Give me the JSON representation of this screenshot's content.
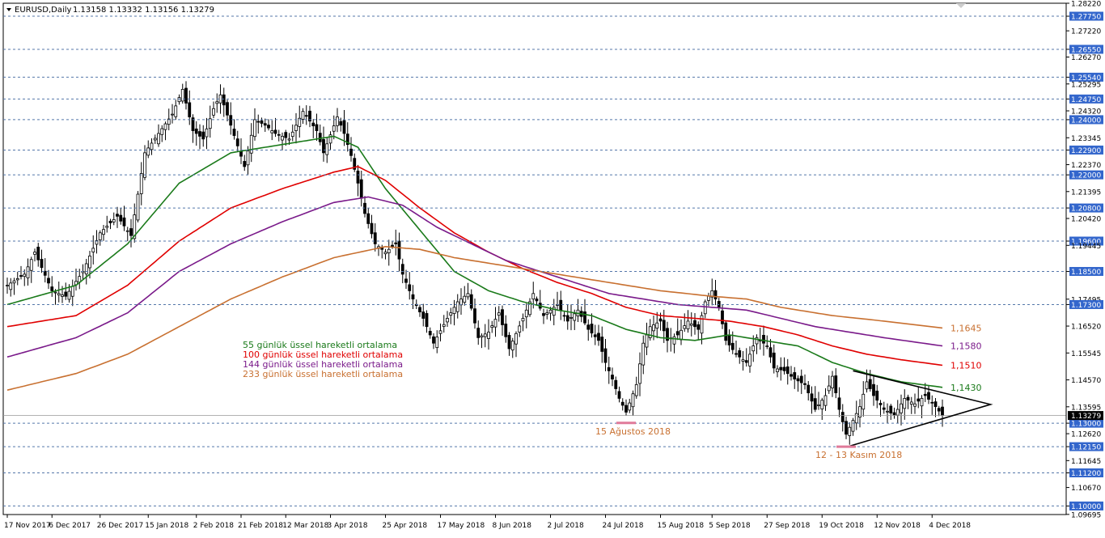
{
  "chart_data": {
    "type": "candlestick",
    "symbol_title": "EURUSD,Daily",
    "ohlc_readout": "1.13158 1.13332 1.13156 1.13279",
    "current_price": "1.13279",
    "ylim": [
      1.0969,
      1.2822
    ],
    "y_ticks": [
      "1.28220",
      "1.27750",
      "1.27220",
      "1.26550",
      "1.26270",
      "1.25540",
      "1.25295",
      "1.24750",
      "1.24320",
      "1.24000",
      "1.23345",
      "1.22900",
      "1.22370",
      "1.22000",
      "1.21395",
      "1.20800",
      "1.20420",
      "1.19600",
      "1.19445",
      "1.18500",
      "1.17495",
      "1.17300",
      "1.16520",
      "1.15545",
      "1.14570",
      "1.13595",
      "1.13000",
      "1.12620",
      "1.12150",
      "1.11645",
      "1.11200",
      "1.10670",
      "1.10000",
      "1.09695"
    ],
    "highlighted_levels": [
      "1.27750",
      "1.26550",
      "1.25540",
      "1.24750",
      "1.24000",
      "1.22900",
      "1.22000",
      "1.20800",
      "1.19600",
      "1.18500",
      "1.17300",
      "1.13000",
      "1.12150",
      "1.11200",
      "1.10000"
    ],
    "x_labels": [
      {
        "label": "17 Nov 2017",
        "i": 0
      },
      {
        "label": "6 Dec 2017",
        "i": 13
      },
      {
        "label": "26 Dec 2017",
        "i": 27
      },
      {
        "label": "15 Jan 2018",
        "i": 41
      },
      {
        "label": "2 Feb 2018",
        "i": 55
      },
      {
        "label": "21 Feb 2018",
        "i": 68
      },
      {
        "label": "12 Mar 2018",
        "i": 81
      },
      {
        "label": "3 Apr 2018",
        "i": 94
      },
      {
        "label": "25 Apr 2018",
        "i": 110
      },
      {
        "label": "17 May 2018",
        "i": 126
      },
      {
        "label": "8 Jun 2018",
        "i": 142
      },
      {
        "label": "2 Jul 2018",
        "i": 158
      },
      {
        "label": "24 Jul 2018",
        "i": 174
      },
      {
        "label": "15 Aug 2018",
        "i": 190
      },
      {
        "label": "5 Sep 2018",
        "i": 205
      },
      {
        "label": "27 Sep 2018",
        "i": 221
      },
      {
        "label": "19 Oct 2018",
        "i": 237
      },
      {
        "label": "12 Nov 2018",
        "i": 253
      },
      {
        "label": "4 Dec 2018",
        "i": 269
      }
    ],
    "price_anchors": [
      [
        0,
        1.18
      ],
      [
        5,
        1.184
      ],
      [
        8,
        1.192
      ],
      [
        13,
        1.178
      ],
      [
        17,
        1.176
      ],
      [
        22,
        1.185
      ],
      [
        27,
        1.199
      ],
      [
        32,
        1.205
      ],
      [
        36,
        1.198
      ],
      [
        40,
        1.228
      ],
      [
        44,
        1.235
      ],
      [
        48,
        1.242
      ],
      [
        51,
        1.251
      ],
      [
        54,
        1.236
      ],
      [
        57,
        1.233
      ],
      [
        60,
        1.244
      ],
      [
        62,
        1.249
      ],
      [
        65,
        1.238
      ],
      [
        69,
        1.223
      ],
      [
        72,
        1.24
      ],
      [
        75,
        1.238
      ],
      [
        78,
        1.235
      ],
      [
        82,
        1.233
      ],
      [
        86,
        1.243
      ],
      [
        90,
        1.236
      ],
      [
        92,
        1.228
      ],
      [
        96,
        1.241
      ],
      [
        98,
        1.235
      ],
      [
        100,
        1.227
      ],
      [
        102,
        1.217
      ],
      [
        104,
        1.206
      ],
      [
        107,
        1.195
      ],
      [
        110,
        1.192
      ],
      [
        113,
        1.195
      ],
      [
        115,
        1.184
      ],
      [
        118,
        1.175
      ],
      [
        121,
        1.168
      ],
      [
        124,
        1.159
      ],
      [
        128,
        1.168
      ],
      [
        131,
        1.174
      ],
      [
        134,
        1.177
      ],
      [
        137,
        1.161
      ],
      [
        140,
        1.163
      ],
      [
        143,
        1.17
      ],
      [
        146,
        1.157
      ],
      [
        150,
        1.168
      ],
      [
        153,
        1.177
      ],
      [
        156,
        1.169
      ],
      [
        160,
        1.173
      ],
      [
        163,
        1.167
      ],
      [
        166,
        1.171
      ],
      [
        169,
        1.164
      ],
      [
        172,
        1.16
      ],
      [
        174,
        1.152
      ],
      [
        176,
        1.146
      ],
      [
        178,
        1.139
      ],
      [
        180,
        1.134
      ],
      [
        183,
        1.144
      ],
      [
        185,
        1.159
      ],
      [
        187,
        1.165
      ],
      [
        190,
        1.167
      ],
      [
        192,
        1.16
      ],
      [
        195,
        1.162
      ],
      [
        198,
        1.167
      ],
      [
        201,
        1.164
      ],
      [
        203,
        1.174
      ],
      [
        205,
        1.178
      ],
      [
        207,
        1.172
      ],
      [
        209,
        1.16
      ],
      [
        212,
        1.155
      ],
      [
        215,
        1.152
      ],
      [
        218,
        1.161
      ],
      [
        221,
        1.158
      ],
      [
        223,
        1.15
      ],
      [
        226,
        1.149
      ],
      [
        229,
        1.146
      ],
      [
        232,
        1.144
      ],
      [
        235,
        1.135
      ],
      [
        238,
        1.14
      ],
      [
        240,
        1.147
      ],
      [
        242,
        1.135
      ],
      [
        244,
        1.126
      ],
      [
        246,
        1.131
      ],
      [
        248,
        1.136
      ],
      [
        250,
        1.145
      ],
      [
        252,
        1.14
      ],
      [
        255,
        1.135
      ],
      [
        258,
        1.133
      ],
      [
        261,
        1.139
      ],
      [
        264,
        1.137
      ],
      [
        267,
        1.14
      ],
      [
        270,
        1.136
      ],
      [
        272,
        1.1328
      ]
    ],
    "ema_series": [
      {
        "name": "55 günlük üssel hareketli ortalama",
        "color": "#1a7a1a",
        "label": "1,1430",
        "end": 1.143,
        "anchors": [
          [
            0,
            1.173
          ],
          [
            20,
            1.18
          ],
          [
            35,
            1.195
          ],
          [
            50,
            1.217
          ],
          [
            65,
            1.228
          ],
          [
            80,
            1.231
          ],
          [
            95,
            1.234
          ],
          [
            102,
            1.23
          ],
          [
            110,
            1.215
          ],
          [
            120,
            1.2
          ],
          [
            130,
            1.185
          ],
          [
            140,
            1.178
          ],
          [
            150,
            1.174
          ],
          [
            160,
            1.171
          ],
          [
            170,
            1.169
          ],
          [
            180,
            1.164
          ],
          [
            190,
            1.161
          ],
          [
            200,
            1.16
          ],
          [
            210,
            1.162
          ],
          [
            220,
            1.16
          ],
          [
            230,
            1.158
          ],
          [
            240,
            1.152
          ],
          [
            250,
            1.148
          ],
          [
            260,
            1.145
          ],
          [
            272,
            1.143
          ]
        ]
      },
      {
        "name": "100 günlük üssel hareketli ortalama",
        "color": "#e00000",
        "label": "1,1510",
        "end": 1.151,
        "anchors": [
          [
            0,
            1.165
          ],
          [
            20,
            1.169
          ],
          [
            35,
            1.18
          ],
          [
            50,
            1.196
          ],
          [
            65,
            1.208
          ],
          [
            80,
            1.215
          ],
          [
            95,
            1.221
          ],
          [
            102,
            1.223
          ],
          [
            110,
            1.218
          ],
          [
            120,
            1.208
          ],
          [
            130,
            1.199
          ],
          [
            140,
            1.192
          ],
          [
            150,
            1.186
          ],
          [
            160,
            1.181
          ],
          [
            170,
            1.177
          ],
          [
            180,
            1.172
          ],
          [
            190,
            1.169
          ],
          [
            200,
            1.168
          ],
          [
            210,
            1.167
          ],
          [
            220,
            1.165
          ],
          [
            230,
            1.162
          ],
          [
            240,
            1.158
          ],
          [
            250,
            1.155
          ],
          [
            260,
            1.153
          ],
          [
            272,
            1.151
          ]
        ]
      },
      {
        "name": "144 günlük üssel hareketli ortalama",
        "color": "#7a1a8a",
        "label": "1,1580",
        "end": 1.158,
        "anchors": [
          [
            0,
            1.154
          ],
          [
            20,
            1.161
          ],
          [
            35,
            1.17
          ],
          [
            50,
            1.185
          ],
          [
            65,
            1.195
          ],
          [
            80,
            1.203
          ],
          [
            95,
            1.21
          ],
          [
            105,
            1.212
          ],
          [
            115,
            1.209
          ],
          [
            125,
            1.201
          ],
          [
            135,
            1.195
          ],
          [
            145,
            1.189
          ],
          [
            155,
            1.185
          ],
          [
            165,
            1.181
          ],
          [
            175,
            1.177
          ],
          [
            185,
            1.175
          ],
          [
            195,
            1.173
          ],
          [
            205,
            1.172
          ],
          [
            215,
            1.171
          ],
          [
            225,
            1.168
          ],
          [
            235,
            1.165
          ],
          [
            245,
            1.163
          ],
          [
            255,
            1.161
          ],
          [
            272,
            1.158
          ]
        ]
      },
      {
        "name": "233 günlük üssel hareketli ortalama",
        "color": "#c87030",
        "label": "1,1645",
        "end": 1.1645,
        "anchors": [
          [
            0,
            1.142
          ],
          [
            20,
            1.148
          ],
          [
            35,
            1.155
          ],
          [
            50,
            1.165
          ],
          [
            65,
            1.175
          ],
          [
            80,
            1.183
          ],
          [
            95,
            1.19
          ],
          [
            110,
            1.194
          ],
          [
            120,
            1.193
          ],
          [
            130,
            1.19
          ],
          [
            145,
            1.187
          ],
          [
            160,
            1.184
          ],
          [
            175,
            1.181
          ],
          [
            190,
            1.178
          ],
          [
            205,
            1.176
          ],
          [
            215,
            1.175
          ],
          [
            225,
            1.172
          ],
          [
            240,
            1.169
          ],
          [
            255,
            1.167
          ],
          [
            272,
            1.1645
          ]
        ]
      }
    ],
    "annotations": [
      {
        "text": "15 Ağustos 2018",
        "i": 180,
        "price": 1.1301
      },
      {
        "text": "12 - 13 Kasım 2018",
        "i": 244,
        "price": 1.1215
      }
    ],
    "triangle": {
      "top": [
        246,
        1.149
      ],
      "bottom": [
        245,
        1.1217
      ],
      "apex": [
        286,
        1.1368
      ]
    },
    "grid": true,
    "colors": {
      "up": "#000000",
      "down": "#000000",
      "grid": "#5577aa",
      "level_box": "#3366cc"
    }
  }
}
